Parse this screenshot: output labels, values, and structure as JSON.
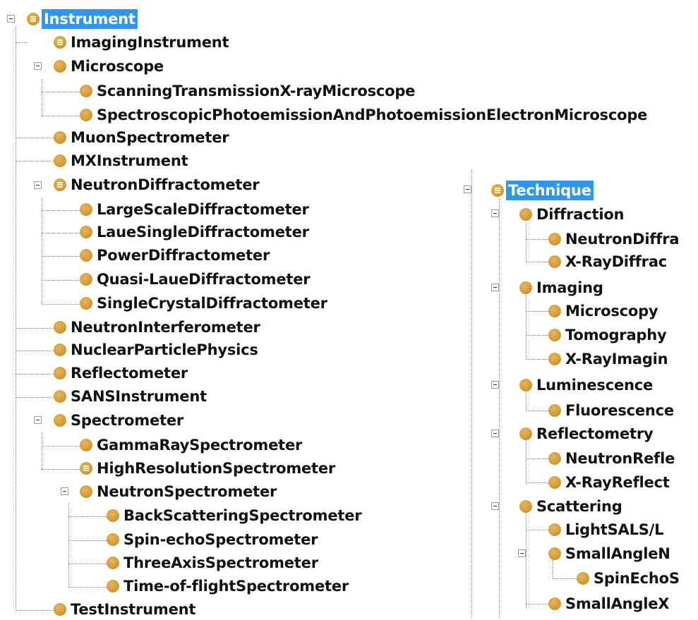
{
  "instrument_tree": {
    "root": "Instrument",
    "children": {
      "imaging_instrument": "ImagingInstrument",
      "microscope": "Microscope",
      "microscope_children": [
        "ScanningTransmissionX-rayMicroscope",
        "SpectroscopicPhotoemissionAndPhotoemissionElectronMicroscope"
      ],
      "muon_spectrometer": "MuonSpectrometer",
      "mx_instrument": "MXInstrument",
      "neutron_diffractometer": "NeutronDiffractometer",
      "neutron_diffractometer_children": [
        "LargeScaleDiffractometer",
        "LaueSingleDiffractometer",
        "PowerDiffractometer",
        "Quasi-LaueDiffractometer",
        "SingleCrystalDiffractometer"
      ],
      "neutron_interferometer": "NeutronInterferometer",
      "nuclear_particle_physics": "NuclearParticlePhysics",
      "reflectometer": "Reflectometer",
      "sans_instrument": "SANSInstrument",
      "spectrometer": "Spectrometer",
      "spectrometer_children": [
        "GammaRaySpectrometer",
        "HighResolutionSpectrometer",
        "NeutronSpectrometer"
      ],
      "neutron_spectrometer_children": [
        "BackScatteringSpectrometer",
        "Spin-echoSpectrometer",
        "ThreeAxisSpectrometer",
        "Time-of-flightSpectrometer"
      ],
      "test_instrument": "TestInstrument"
    }
  },
  "technique_tree": {
    "root": "Technique",
    "diffraction": "Diffraction",
    "diffraction_children": [
      "NeutronDiffra",
      "X-RayDiffrac"
    ],
    "imaging": "Imaging",
    "imaging_children": [
      "Microscopy",
      "Tomography",
      "X-RayImagin"
    ],
    "luminescence": "Luminescence",
    "luminescence_children": [
      "Fluorescence"
    ],
    "reflectometry": "Reflectometry",
    "reflectometry_children": [
      "NeutronRefle",
      "X-RayReflect"
    ],
    "scattering": "Scattering",
    "scattering_children": [
      "LightSALS/L",
      "SmallAngleN",
      "SmallAngleX"
    ],
    "small_angle_n_children": [
      "SpinEchoS"
    ]
  },
  "colors": {
    "selection": "#2f95ee",
    "class_icon": "#d49b34"
  },
  "icons": {
    "class": "circle-icon",
    "defined_class": "defined-class-icon",
    "expander": "collapse-toggle-icon"
  }
}
